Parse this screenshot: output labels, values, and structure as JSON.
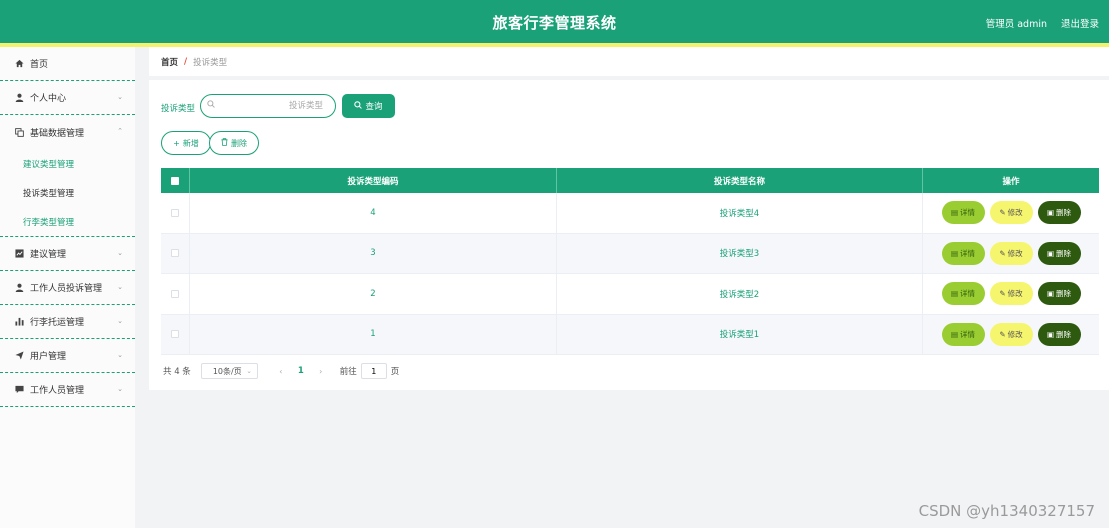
{
  "header": {
    "title": "旅客行李管理系统",
    "user": "管理员 admin",
    "logout": "退出登录",
    "accent": "#1aa178",
    "stripe": "#f3f26e"
  },
  "sidebar": {
    "items": [
      {
        "label": "首页",
        "icon": "home-icon"
      },
      {
        "label": "个人中心",
        "icon": "user-icon",
        "expandable": true
      },
      {
        "label": "基础数据管理",
        "icon": "copy-icon",
        "expandable": true,
        "expanded": true,
        "children": [
          "建议类型管理",
          "投诉类型管理",
          "行李类型管理"
        ],
        "active_child": 1
      },
      {
        "label": "建议管理",
        "icon": "chart-box-icon",
        "expandable": true
      },
      {
        "label": "工作人员投诉管理",
        "icon": "user-icon",
        "expandable": true
      },
      {
        "label": "行李托运管理",
        "icon": "bar-chart-icon",
        "expandable": true
      },
      {
        "label": "用户管理",
        "icon": "send-icon",
        "expandable": true
      },
      {
        "label": "工作人员管理",
        "icon": "message-icon",
        "expandable": true
      }
    ]
  },
  "breadcrumb": {
    "home": "首页",
    "separator": "/",
    "current": "投诉类型"
  },
  "search": {
    "label": "投诉类型",
    "placeholder": "投诉类型",
    "value": "",
    "button": "查询"
  },
  "actions": {
    "add": "新增",
    "delete": "删除"
  },
  "table": {
    "columns": [
      "投诉类型编码",
      "投诉类型名称",
      "操作"
    ],
    "rows": [
      {
        "code": "4",
        "name": "投诉类型4"
      },
      {
        "code": "3",
        "name": "投诉类型3"
      },
      {
        "code": "2",
        "name": "投诉类型2"
      },
      {
        "code": "1",
        "name": "投诉类型1"
      }
    ],
    "row_actions": {
      "detail": "详情",
      "edit": "修改",
      "delete": "删除"
    }
  },
  "pagination": {
    "total": "共 4 条",
    "page_size": "10条/页",
    "current_page": "1",
    "goto_label": "前往",
    "goto_value": "1",
    "page_unit": "页"
  },
  "watermark": "CSDN @yh1340327157"
}
